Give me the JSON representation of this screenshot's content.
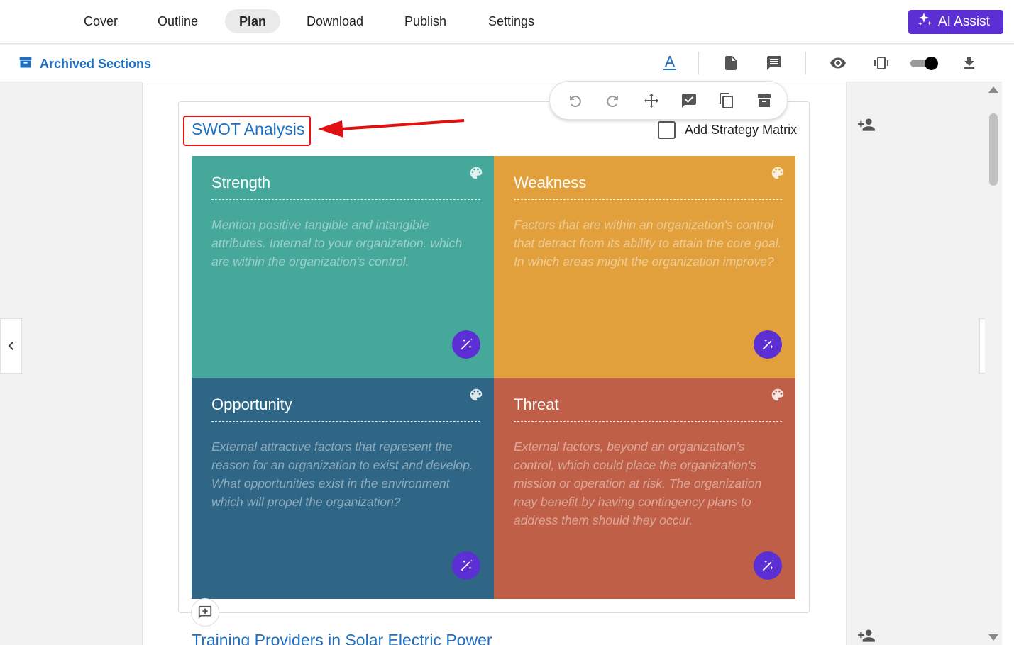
{
  "nav": {
    "tabs": [
      {
        "label": "Cover"
      },
      {
        "label": "Outline"
      },
      {
        "label": "Plan",
        "active": true
      },
      {
        "label": "Download"
      },
      {
        "label": "Publish"
      },
      {
        "label": "Settings"
      }
    ],
    "ai_assist_label": "AI Assist"
  },
  "toolbar": {
    "archived_label": "Archived Sections"
  },
  "section": {
    "title": "SWOT Analysis",
    "strategy_matrix_label": "Add Strategy Matrix",
    "strategy_matrix_checked": false
  },
  "swot": [
    {
      "title": "Strength",
      "color": "#46a89b",
      "description": "Mention positive tangible and intangible attributes. Internal to your organization. which are within the organization's control."
    },
    {
      "title": "Weakness",
      "color": "#e2a03c",
      "description": "Factors that are within an organization's control that detract from its ability to attain the core goal. In which areas might the organization improve?"
    },
    {
      "title": "Opportunity",
      "color": "#2f6585",
      "description": "External attractive factors that represent the reason for an organization to exist and develop. What opportunities exist in the environment which will propel the organization?"
    },
    {
      "title": "Threat",
      "color": "#c05f47",
      "description": "External factors, beyond an organization's control, which could place the organization's mission or operation at risk. The organization may benefit by having contingency plans to address them should they occur."
    }
  ],
  "next_section_title": "Training Providers in Solar Electric Power",
  "colors": {
    "accent": "#5b2fd3",
    "link": "#1e6fc1",
    "highlight": "#e11111"
  }
}
